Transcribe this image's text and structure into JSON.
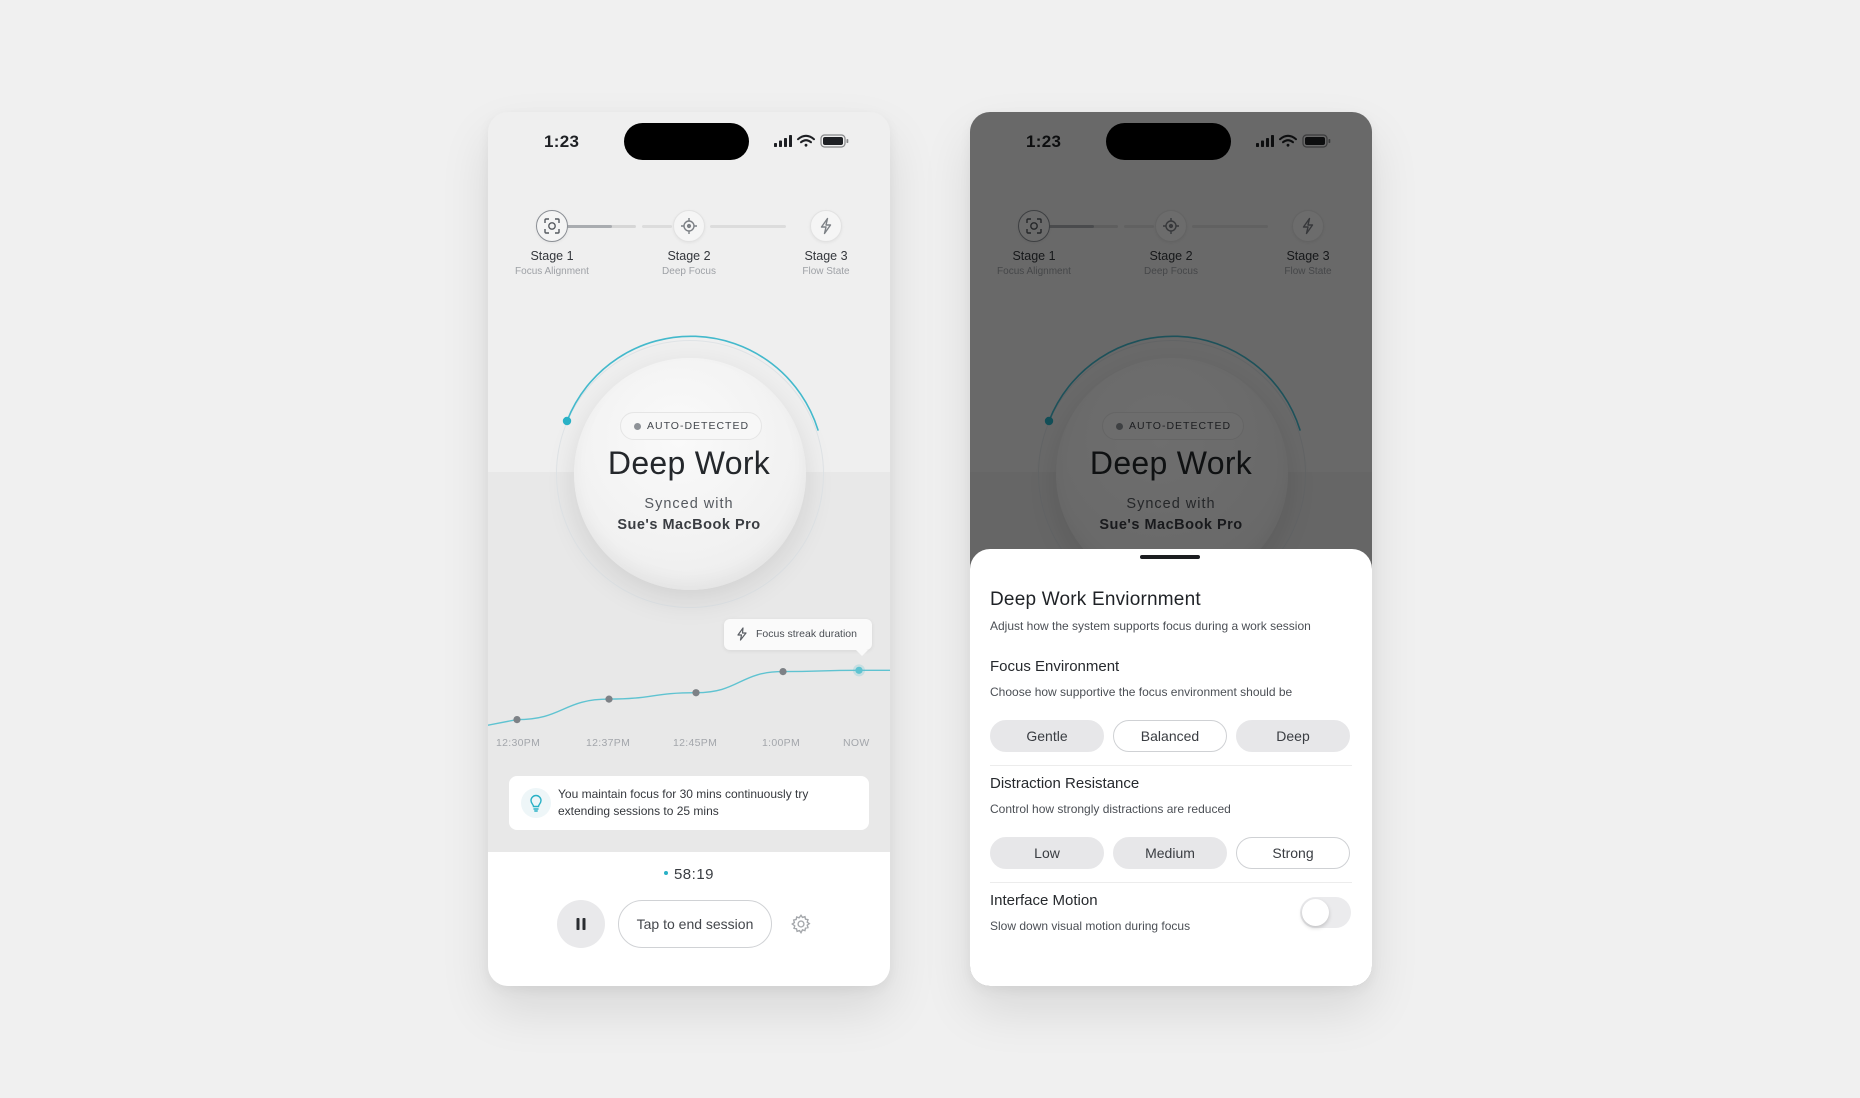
{
  "status_bar": {
    "time": "1:23"
  },
  "stages": [
    {
      "title": "Stage 1",
      "subtitle": "Focus Alignment"
    },
    {
      "title": "Stage 2",
      "subtitle": "Deep Focus"
    },
    {
      "title": "Stage 3",
      "subtitle": "Flow State"
    }
  ],
  "focus": {
    "badge": "AUTO-DETECTED",
    "mode": "Deep Work",
    "synced_label": "Synced with",
    "device": "Sue's MacBook Pro"
  },
  "tooltip": {
    "label": "Focus streak duration"
  },
  "chart_data": {
    "type": "line",
    "categories": [
      "12:30PM",
      "12:37PM",
      "12:45PM",
      "1:00PM",
      "NOW"
    ],
    "series": [
      {
        "values": [
          0.1,
          0.42,
          0.52,
          0.85,
          0.87
        ]
      }
    ],
    "accent": "#5fc3d1"
  },
  "tip": {
    "text": "You maintain focus for 30 mins continuously try extending sessions to 25 mins"
  },
  "session": {
    "timer": "58:19",
    "end_label": "Tap to end session"
  },
  "sheet": {
    "title": "Deep Work Enviornment",
    "subtitle": "Adjust how the system supports focus during a work session",
    "focus_env": {
      "title": "Focus Environment",
      "subtitle": "Choose how supportive the focus environment should be",
      "options": [
        "Gentle",
        "Balanced",
        "Deep"
      ],
      "selected": "Balanced"
    },
    "distraction": {
      "title": "Distraction Resistance",
      "subtitle": "Control how strongly distractions are reduced",
      "options": [
        "Low",
        "Medium",
        "Strong"
      ],
      "selected": "Strong"
    },
    "motion": {
      "title": "Interface Motion",
      "subtitle": "Slow down visual motion during focus",
      "enabled": false
    }
  },
  "colors": {
    "accent": "#29b1c6",
    "background": "#f0f0f0",
    "overlay": "#000000"
  }
}
